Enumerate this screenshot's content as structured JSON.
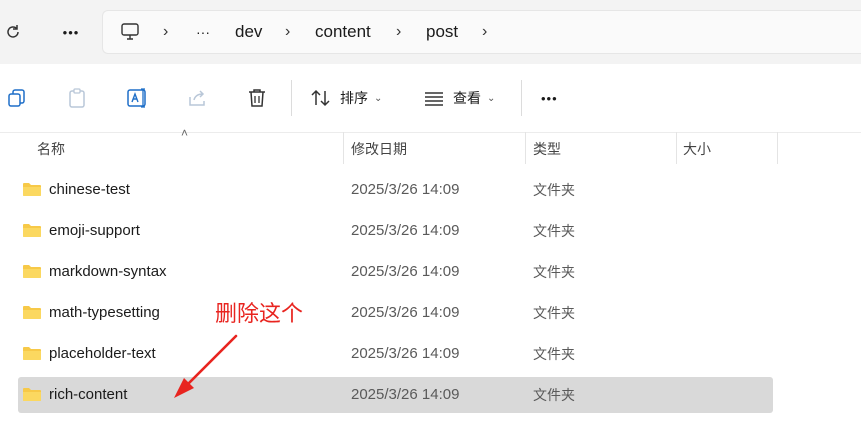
{
  "address_bar": {
    "crumbs": [
      "dev",
      "content",
      "post"
    ],
    "ellipsis": "···",
    "more": "•••"
  },
  "toolbar": {
    "sort_label": "排序",
    "view_label": "查看",
    "more": "•••"
  },
  "columns": {
    "name": "名称",
    "date": "修改日期",
    "type": "类型",
    "size": "大小"
  },
  "files": [
    {
      "name": "chinese-test",
      "date": "2025/3/26 14:09",
      "type": "文件夹"
    },
    {
      "name": "emoji-support",
      "date": "2025/3/26 14:09",
      "type": "文件夹"
    },
    {
      "name": "markdown-syntax",
      "date": "2025/3/26 14:09",
      "type": "文件夹"
    },
    {
      "name": "math-typesetting",
      "date": "2025/3/26 14:09",
      "type": "文件夹"
    },
    {
      "name": "placeholder-text",
      "date": "2025/3/26 14:09",
      "type": "文件夹"
    },
    {
      "name": "rich-content",
      "date": "2025/3/26 14:09",
      "type": "文件夹"
    }
  ],
  "annotation": "删除这个",
  "colors": {
    "annotation": "#e8241f",
    "folder": "#f7c948",
    "selected_row": "#d9d9d9"
  },
  "icons": [
    "refresh-icon",
    "more-icon",
    "computer-icon",
    "copy-icon",
    "paste-icon",
    "rename-icon",
    "share-icon",
    "delete-icon",
    "sort-icon",
    "view-icon",
    "folder-icon",
    "arrow-icon"
  ]
}
